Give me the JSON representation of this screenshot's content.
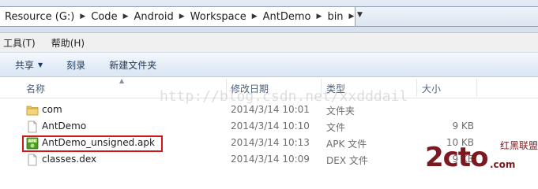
{
  "address": {
    "crumbs": [
      "Resource (G:)",
      "Code",
      "Android",
      "Workspace",
      "AntDemo",
      "bin"
    ]
  },
  "menu": {
    "tools": "工具(T)",
    "help": "帮助(H)"
  },
  "toolbar": {
    "share": "共享",
    "burn": "刻录",
    "new_folder": "新建文件夹"
  },
  "columns": {
    "name": "名称",
    "date": "修改日期",
    "type": "类型",
    "size": "大小"
  },
  "files": [
    {
      "name": "com",
      "date": "2014/3/14 10:01",
      "type": "文件夹",
      "size": "",
      "icon": "folder-icon"
    },
    {
      "name": "AntDemo",
      "date": "2014/3/14 10:10",
      "type": "文件",
      "size": "9 KB",
      "icon": "file-icon"
    },
    {
      "name": "AntDemo_unsigned.apk",
      "date": "2014/3/14 10:13",
      "type": "APK 文件",
      "size": "10 KB",
      "icon": "apk-icon"
    },
    {
      "name": "classes.dex",
      "date": "2014/3/14 10:09",
      "type": "DEX 文件",
      "size": "9 KB",
      "icon": "file-icon"
    }
  ],
  "watermark": "http://blog.csdn.net/xxdddail",
  "brand": {
    "big": "2cto",
    "top": "红黑联盟",
    "url": ".com"
  },
  "colors": {
    "highlight_border": "#d11818",
    "toolbar_text": "#1e395b",
    "brand": "#7a1a20"
  }
}
